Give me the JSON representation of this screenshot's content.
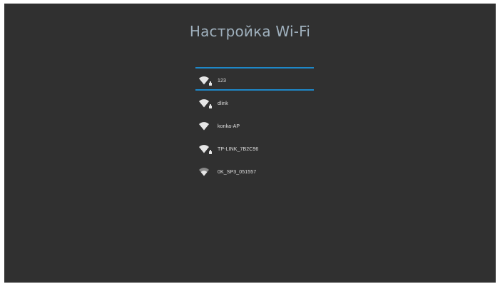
{
  "title": "Настройка Wi-Fi",
  "networks": [
    {
      "ssid": "123",
      "icon": "wifi-secured-icon",
      "secured": true,
      "selected": true
    },
    {
      "ssid": "dlink",
      "icon": "wifi-secured-icon",
      "secured": true,
      "selected": false
    },
    {
      "ssid": "konka-AP",
      "icon": "wifi-icon",
      "secured": false,
      "selected": false
    },
    {
      "ssid": "TP-LINK_7B2C96",
      "icon": "wifi-secured-icon",
      "secured": true,
      "selected": false
    },
    {
      "ssid": "0K_SP3_051557",
      "icon": "wifi-icon",
      "secured": false,
      "selected": false
    }
  ],
  "colors": {
    "background": "#303030",
    "title": "#9fb0bd",
    "selection": "#1e88c8",
    "text": "#e0e0e0"
  }
}
